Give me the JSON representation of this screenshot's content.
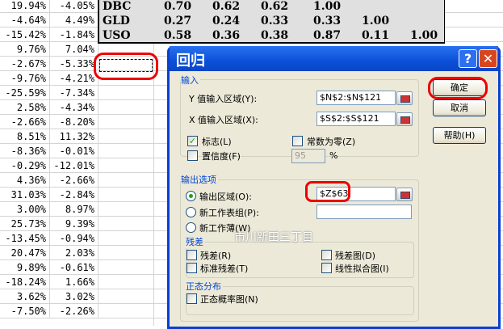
{
  "sheet": {
    "rows": [
      [
        "19.94%",
        "-4.05%"
      ],
      [
        "-4.64%",
        "4.49%"
      ],
      [
        "-15.42%",
        "-1.84%"
      ],
      [
        "9.76%",
        "7.04%"
      ],
      [
        "-2.67%",
        "-5.33%"
      ],
      [
        "-9.76%",
        "-4.21%"
      ],
      [
        "-25.59%",
        "-7.34%"
      ],
      [
        "2.58%",
        "-4.34%"
      ],
      [
        "-2.66%",
        "-8.20%"
      ],
      [
        "8.51%",
        "11.32%"
      ],
      [
        "-8.36%",
        "-0.01%"
      ],
      [
        "-0.29%",
        "-12.01%"
      ],
      [
        "4.36%",
        "-2.66%"
      ],
      [
        "31.03%",
        "-2.84%"
      ],
      [
        "3.00%",
        "8.97%"
      ],
      [
        "25.73%",
        "9.39%"
      ],
      [
        "-13.45%",
        "-0.94%"
      ],
      [
        "20.47%",
        "2.03%"
      ],
      [
        "9.89%",
        "-0.61%"
      ],
      [
        "-18.24%",
        "1.66%"
      ],
      [
        "3.62%",
        "3.02%"
      ],
      [
        "-7.50%",
        "-2.26%"
      ]
    ],
    "corr": [
      [
        "DBC",
        "0.70",
        "0.62",
        "0.62",
        "1.00"
      ],
      [
        "GLD",
        "0.27",
        "0.24",
        "0.33",
        "0.33",
        "1.00"
      ],
      [
        "USO",
        "0.58",
        "0.36",
        "0.38",
        "0.87",
        "0.11",
        "1.00"
      ]
    ]
  },
  "dialog": {
    "title": "回归",
    "help_icon": "?",
    "close_icon": "✕",
    "input_group": "输入",
    "y_label": "Y 值输入区域(Y):",
    "y_value": "$N$2:$N$121",
    "x_label": "X 值输入区域(X):",
    "x_value": "$S$2:$S$121",
    "labels": "标志(L)",
    "labels_checked": true,
    "const_zero": "常数为零(Z)",
    "confidence": "置信度(F)",
    "confidence_value": "95",
    "percent": "%",
    "output_group": "输出选项",
    "out_range": "输出区域(O):",
    "out_range_value": "$Z$63",
    "new_sheet": "新工作表组(P):",
    "new_book": "新工作薄(W)",
    "residual_group": "残差",
    "residuals": "残差(R)",
    "residual_plots": "残差图(D)",
    "std_residuals": "标准残差(T)",
    "line_fit": "线性拟合图(I)",
    "normal_group": "正态分布",
    "normal_plot": "正态概率图(N)",
    "ok": "确定",
    "cancel": "取消",
    "help": "帮助(H)"
  },
  "watermark": "市川新田三丁目"
}
